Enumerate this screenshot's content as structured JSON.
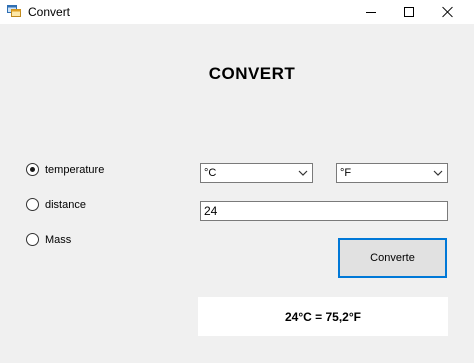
{
  "window": {
    "title": "Convert",
    "icons": {
      "app": "app-window-icon",
      "minimize": "minimize-icon",
      "maximize": "maximize-icon",
      "close": "close-icon"
    }
  },
  "heading": "CONVERT",
  "radios": [
    {
      "label": "temperature",
      "checked": true
    },
    {
      "label": "distance",
      "checked": false
    },
    {
      "label": "Mass",
      "checked": false
    }
  ],
  "from_unit": {
    "value": "°C",
    "icon": "chevron-down-icon"
  },
  "to_unit": {
    "value": "°F",
    "icon": "chevron-down-icon"
  },
  "input_value": "24",
  "convert_button": "Converte",
  "result": "24°C = 75,2°F",
  "colors": {
    "accent_border": "#0078d7",
    "form_bg": "#f0f0f0"
  }
}
